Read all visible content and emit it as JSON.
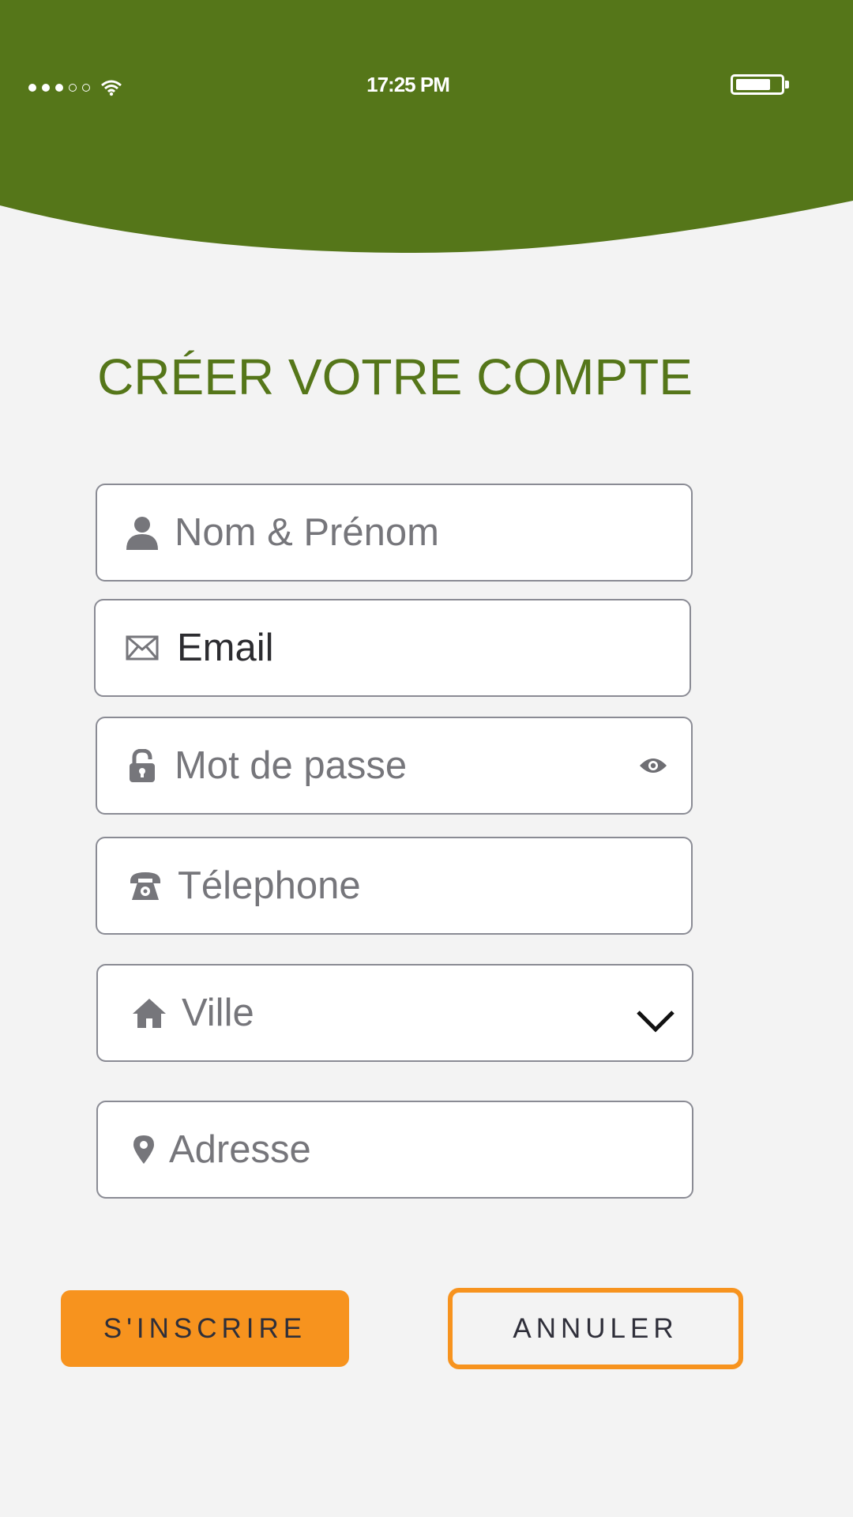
{
  "status_bar": {
    "time": "17:25 PM",
    "signal_dots_filled": 3,
    "signal_dots_total": 5,
    "battery_level": 0.8
  },
  "colors": {
    "header_green": "#557619",
    "accent_orange": "#f7931e",
    "background": "#f3f3f3"
  },
  "page": {
    "title": "CRÉER VOTRE COMPTE"
  },
  "form": {
    "name": {
      "placeholder": "Nom & Prénom",
      "icon": "user-icon"
    },
    "email": {
      "value": "Email",
      "icon": "envelope-icon"
    },
    "password": {
      "placeholder": "Mot de passe",
      "icon": "lock-icon",
      "toggle_icon": "eye-icon"
    },
    "phone": {
      "placeholder": "Télephone",
      "icon": "phone-icon"
    },
    "city": {
      "placeholder": "Ville",
      "icon": "home-icon",
      "dropdown_icon": "chevron-down-icon"
    },
    "address": {
      "placeholder": "Adresse",
      "icon": "map-pin-icon"
    }
  },
  "buttons": {
    "submit": "S'INSCRIRE",
    "cancel": "ANNULER"
  }
}
